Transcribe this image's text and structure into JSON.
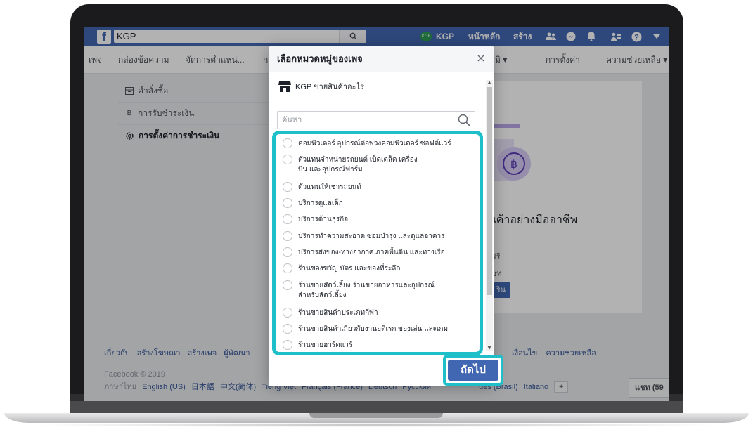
{
  "topbar": {
    "logo": "f",
    "search_value": "KGP",
    "kgp_pill": "KGP",
    "profile_name": "KGP",
    "home_label": "หน้าหลัก",
    "create_label": "สร้าง"
  },
  "tabs": [
    {
      "label": "เพจ"
    },
    {
      "label": "กล่องข้อความ"
    },
    {
      "label": "จัดการตำแหน่..."
    },
    {
      "label": "ก"
    },
    {
      "label": "มิ ▾"
    },
    {
      "label": "การตั้งค่า"
    },
    {
      "label": "ความช่วยเหลือ ▾"
    }
  ],
  "side_menu": {
    "orders": "คำสั่งซื้อ",
    "payouts": "การรับชำระเงิน",
    "payment_settings": "การตั้งค่าการชำระเงิน",
    "currency_symbol": "฿"
  },
  "right_card": {
    "title": "สินค้าอย่างมืออาชีพ",
    "line1": "ที",
    "line2": "ได้ฟรี",
    "line3": "กแชท",
    "button": "ริน",
    "baht_symbol": "฿"
  },
  "modal": {
    "title": "เลือกหมวดหมู่ของเพจ",
    "close": "×",
    "store_label": "KGP ขายสินค้าอะไร",
    "search_placeholder": "ค้นหา",
    "categories": [
      "คอมพิวเตอร์ อุปกรณ์ต่อพ่วงคอมพิวเตอร์ ซอฟต์แวร์",
      "ตัวแทนจำหน่ายรถยนต์ เบ็ดเตล็ด เครื่องบิน และอุปกรณ์ฟาร์ม",
      "ตัวแทนให้เช่ารถยนต์",
      "บริการดูแลเด็ก",
      "บริการด้านธุรกิจ",
      "บริการทำความสะอาด ซ่อมบำรุง และดูแลอาคาร",
      "บริการส่งของ-ทางอากาศ ภาคพื้นดิน และทางเรือ",
      "ร้านของขวัญ บัตร และของที่ระลึก",
      "ร้านขายสัตว์เลี้ยง ร้านขายอาหารและอุปกรณ์สำหรับสัตว์เลี้ยง",
      "ร้านขายสินค้าประเภทกีฬา",
      "ร้านขายสินค้าเกี่ยวกับงานอดิเรก ของเล่น และเกม",
      "ร้านขายฮาร์ดแวร์"
    ],
    "next_button": "ถัดไป"
  },
  "footer": {
    "links": [
      "เกี่ยวกับ",
      "สร้างโฆษณา",
      "สร้างเพจ",
      "ผู้พัฒนา"
    ],
    "right_links": [
      "เงื่อนไข",
      "ความช่วยเหลือ"
    ],
    "copyright": "Facebook © 2019",
    "languages": [
      "ภาษาไทย",
      "English (US)",
      "日本語",
      "中文(简体)",
      "Tiếng Việt",
      "Français (France)",
      "Deutsch",
      "Русский",
      "uês (Brasil)",
      "Italiano"
    ],
    "lang_more": "+",
    "chat": "แชท (59"
  },
  "colors": {
    "fb_blue": "#4267b2",
    "highlight": "#1fbfc9",
    "overlay": "rgba(0,0,0,0.30)"
  }
}
